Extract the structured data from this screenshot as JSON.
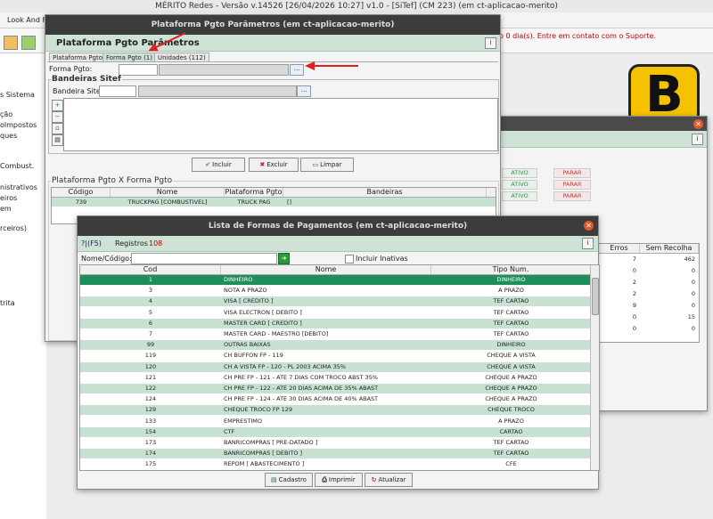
{
  "app": {
    "title": "MÉRITO Redes - Versão v.14526 [26/04/2026 10:27] v1.0 - [SiTef] (CM 223) (em ct-aplicacao-merito)",
    "menu_item": "Look And Fe",
    "support_msg": "o 0 dia(s). Entre em contato com o Suporte."
  },
  "left_menu": [
    "s Sistema",
    "ção",
    "olmpostos",
    "ques",
    "Combust.",
    "nistrativos",
    "eiros",
    "em",
    "rceiros)",
    "trita"
  ],
  "param_window": {
    "title": "Plataforma Pgto Parâmetros (em ct-aplicacao-merito)",
    "header": "Plataforma Pgto Parâmetros",
    "tabs": [
      "Plataforma Pgto",
      "Forma Pgto (1)",
      "Unidades (112)"
    ],
    "forma_pgto_label": "Forma Pgto:",
    "bandeiras_group": "Bandeiras Sitef",
    "bandeira_label": "Bandeira Sitef:",
    "search_btn": "...",
    "incluir": "Incluir",
    "excluir": "Excluir",
    "limpar": "Limpar",
    "grid_group": "Plataforma Pgto X Forma Pgto",
    "grid_cols": [
      "Código",
      "Nome",
      "Plataforma Pgto",
      "Bandeiras"
    ],
    "grid_row": [
      "739",
      "TRUCKPAG [COMBUSTIVEL]",
      "TRUCK PAG",
      "[]"
    ]
  },
  "bg_window": {
    "status_rows": [
      [
        "ATIVO",
        "PARAR"
      ],
      [
        "ATIVO",
        "PARAR"
      ],
      [
        "ATIVO",
        "PARAR"
      ]
    ],
    "cols": [
      "Erros",
      "Sem Recolha"
    ],
    "rows": [
      [
        "7",
        "462"
      ],
      [
        "0",
        "0"
      ],
      [
        "2",
        "0"
      ],
      [
        "2",
        "0"
      ],
      [
        "9",
        "0"
      ],
      [
        "0",
        "15"
      ],
      [
        "0",
        "0"
      ]
    ]
  },
  "list_window": {
    "title": "Lista de Formas de Pagamentos (em ct-aplicacao-merito)",
    "help": "?|(F5)",
    "registros_label": "Registros",
    "registros_count": "108",
    "filter_label": "Nome/Código:",
    "inativas_label": "Incluir Inativas",
    "cols": [
      "Cod",
      "Nome",
      "Tipo Num."
    ],
    "rows": [
      [
        "1",
        "DINHEIRO",
        "DINHEIRO"
      ],
      [
        "3",
        "NOTA A PRAZO",
        "A PRAZO"
      ],
      [
        "4",
        "VISA [ CREDITO ]",
        "TEF CARTAO"
      ],
      [
        "5",
        "VISA ELECTRON [ DEBITO ]",
        "TEF CARTAO"
      ],
      [
        "6",
        "MASTER CARD [ CREDITO ]",
        "TEF CARTAO"
      ],
      [
        "7",
        "MASTER CARD - MAESTRO [DEBITO]",
        "TEF CARTAO"
      ],
      [
        "99",
        "OUTRAS BAIXAS",
        "DINHEIRO"
      ],
      [
        "119",
        "CH BUFFON FP - 119",
        "CHEQUE A VISTA"
      ],
      [
        "120",
        "CH A VISTA FP - 120 - PL 2003  ACIMA 35%",
        "CHEQUE A VISTA"
      ],
      [
        "121",
        "CH PRE FP - 121 - ATE 7 DIAS COM TROCO ABST 35%",
        "CHEQUE A PRAZO"
      ],
      [
        "122",
        "CH PRE FP - 122 - ATE 20 DIAS ACIMA DE 35% ABAST",
        "CHEQUE A PRAZO"
      ],
      [
        "124",
        "CH PRE FP - 124 - ATE 30 DIAS ACIMA DE 40% ABAST",
        "CHEQUE A PRAZO"
      ],
      [
        "129",
        "CHEQUE TROCO FP 129",
        "CHEQUE TROCO"
      ],
      [
        "133",
        "EMPRESTIMO",
        "A PRAZO"
      ],
      [
        "154",
        "CTF",
        "CARTAO"
      ],
      [
        "173",
        "BANRICOMPRAS [ PRE-DATADO ]",
        "TEF CARTAO"
      ],
      [
        "174",
        "BANRICOMPRAS [ DEBITO ]",
        "TEF CARTAO"
      ],
      [
        "175",
        "REPOM  [ ABASTECIMENTO ]",
        "CFE"
      ]
    ],
    "cadastro": "Cadastro",
    "imprimir": "Imprimir",
    "atualizar": "Atualizar"
  },
  "colors": {
    "header_green": "#cfe2d6",
    "row_green": "#c7e2d2",
    "selected": "#1f8f5a",
    "accent_red": "#c00000"
  }
}
